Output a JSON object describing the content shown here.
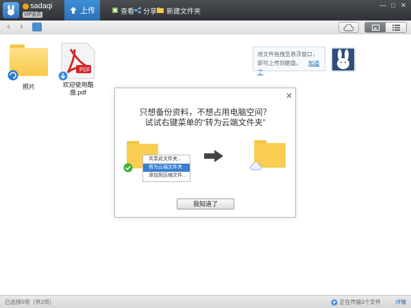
{
  "app": {
    "user_name": "sadaqi",
    "user_badge": "VIP会员"
  },
  "toolbar": {
    "upload_label": "上传",
    "view_label": "查看",
    "share_label": "分享",
    "new_folder_label": "新建文件夹"
  },
  "window_controls": [
    "—",
    "□",
    "✕"
  ],
  "files": [
    {
      "name": "照片",
      "type": "folder"
    },
    {
      "name": "欢迎使用酷盘.pdf",
      "type": "pdf"
    }
  ],
  "tooltip": {
    "text": "将文件拖拽至悬浮窗口，即可上传到酷盘。",
    "link": "知道了"
  },
  "dialog": {
    "line1": "只想备份资料，不想占用电脑空间？",
    "line2": "试试右键菜单的“转为云端文件夹”",
    "menu_items": [
      "共享此文件夹...",
      "转为云端文件夹",
      "添加到压缩文件..."
    ],
    "button_label": "我知道了"
  },
  "status": {
    "selection": "已选择0项（共2项）",
    "transfer": "正在传输3个文件",
    "detail": "详情"
  },
  "colors": {
    "accent": "#2a6fb6",
    "folder": "#f7c94a",
    "pdf_red": "#d4262b"
  }
}
